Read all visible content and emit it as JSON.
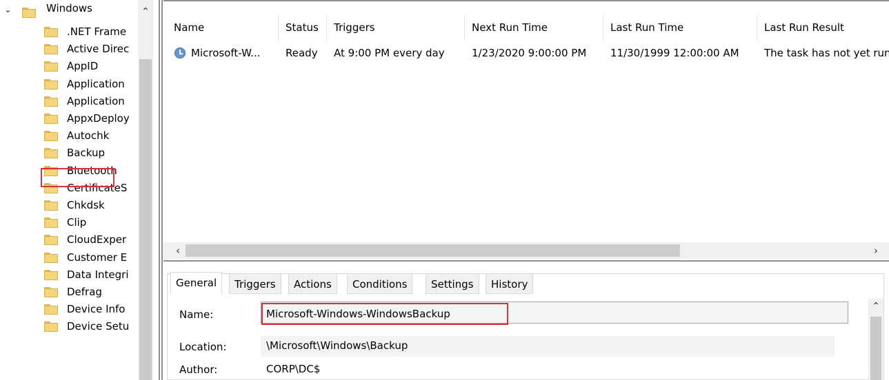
{
  "tree": {
    "root_label": "Windows",
    "items": [
      ".NET Frame",
      "Active Direc",
      "AppID",
      "Application",
      "Application",
      "AppxDeploy",
      "Autochk",
      "Backup",
      "Bluetooth",
      "CertificateS",
      "Chkdsk",
      "Clip",
      "CloudExper",
      "Customer E",
      "Data Integri",
      "Defrag",
      "Device Info",
      "Device Setu"
    ],
    "selected": "Backup"
  },
  "list": {
    "columns": [
      "Name",
      "Status",
      "Triggers",
      "Next Run Time",
      "Last Run Time",
      "Last Run Result"
    ],
    "rows": [
      {
        "name": "Microsoft-W...",
        "status": "Ready",
        "triggers": "At 9:00 PM every day",
        "next_run": "1/23/2020 9:00:00 PM",
        "last_run": "11/30/1999 12:00:00 AM",
        "last_result": "The task has not yet run."
      }
    ]
  },
  "details": {
    "tabs": [
      "General",
      "Triggers",
      "Actions",
      "Conditions",
      "Settings",
      "History"
    ],
    "active_tab": "General",
    "name_label": "Name:",
    "name_value": "Microsoft-Windows-WindowsBackup",
    "location_label": "Location:",
    "location_value": "\\Microsoft\\Windows\\Backup",
    "author_label": "Author:",
    "author_value": "CORP\\DC$"
  },
  "icons": {
    "folder": "folder-icon",
    "task": "clock-task-icon",
    "expander": "chevron-down-icon"
  },
  "colors": {
    "highlight": "#d9303b",
    "folder": "#f4d57c"
  }
}
